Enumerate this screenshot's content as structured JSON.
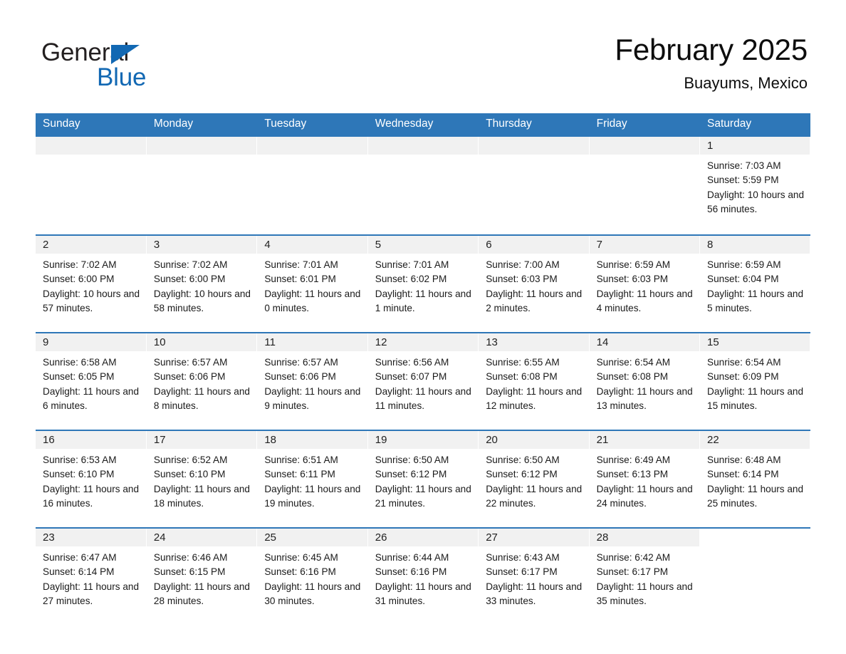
{
  "brand": {
    "name_part1": "General",
    "name_part2": "Blue",
    "triangle_color": "#1268b3",
    "text_color": "#231f20"
  },
  "header": {
    "title": "February 2025",
    "subtitle": "Buayums, Mexico"
  },
  "theme": {
    "header_blue": "#2e77b8",
    "daynum_band": "#f1f1f1",
    "cell_bg": "#ffffff",
    "text": "#1a1a1a"
  },
  "calendar": {
    "weekday_headers": [
      "Sunday",
      "Monday",
      "Tuesday",
      "Wednesday",
      "Thursday",
      "Friday",
      "Saturday"
    ],
    "weeks": [
      [
        {
          "blank": true
        },
        {
          "blank": true
        },
        {
          "blank": true
        },
        {
          "blank": true
        },
        {
          "blank": true
        },
        {
          "blank": true
        },
        {
          "day": "1",
          "sunrise": "Sunrise: 7:03 AM",
          "sunset": "Sunset: 5:59 PM",
          "daylight": "Daylight: 10 hours and 56 minutes."
        }
      ],
      [
        {
          "day": "2",
          "sunrise": "Sunrise: 7:02 AM",
          "sunset": "Sunset: 6:00 PM",
          "daylight": "Daylight: 10 hours and 57 minutes."
        },
        {
          "day": "3",
          "sunrise": "Sunrise: 7:02 AM",
          "sunset": "Sunset: 6:00 PM",
          "daylight": "Daylight: 10 hours and 58 minutes."
        },
        {
          "day": "4",
          "sunrise": "Sunrise: 7:01 AM",
          "sunset": "Sunset: 6:01 PM",
          "daylight": "Daylight: 11 hours and 0 minutes."
        },
        {
          "day": "5",
          "sunrise": "Sunrise: 7:01 AM",
          "sunset": "Sunset: 6:02 PM",
          "daylight": "Daylight: 11 hours and 1 minute."
        },
        {
          "day": "6",
          "sunrise": "Sunrise: 7:00 AM",
          "sunset": "Sunset: 6:03 PM",
          "daylight": "Daylight: 11 hours and 2 minutes."
        },
        {
          "day": "7",
          "sunrise": "Sunrise: 6:59 AM",
          "sunset": "Sunset: 6:03 PM",
          "daylight": "Daylight: 11 hours and 4 minutes."
        },
        {
          "day": "8",
          "sunrise": "Sunrise: 6:59 AM",
          "sunset": "Sunset: 6:04 PM",
          "daylight": "Daylight: 11 hours and 5 minutes."
        }
      ],
      [
        {
          "day": "9",
          "sunrise": "Sunrise: 6:58 AM",
          "sunset": "Sunset: 6:05 PM",
          "daylight": "Daylight: 11 hours and 6 minutes."
        },
        {
          "day": "10",
          "sunrise": "Sunrise: 6:57 AM",
          "sunset": "Sunset: 6:06 PM",
          "daylight": "Daylight: 11 hours and 8 minutes."
        },
        {
          "day": "11",
          "sunrise": "Sunrise: 6:57 AM",
          "sunset": "Sunset: 6:06 PM",
          "daylight": "Daylight: 11 hours and 9 minutes."
        },
        {
          "day": "12",
          "sunrise": "Sunrise: 6:56 AM",
          "sunset": "Sunset: 6:07 PM",
          "daylight": "Daylight: 11 hours and 11 minutes."
        },
        {
          "day": "13",
          "sunrise": "Sunrise: 6:55 AM",
          "sunset": "Sunset: 6:08 PM",
          "daylight": "Daylight: 11 hours and 12 minutes."
        },
        {
          "day": "14",
          "sunrise": "Sunrise: 6:54 AM",
          "sunset": "Sunset: 6:08 PM",
          "daylight": "Daylight: 11 hours and 13 minutes."
        },
        {
          "day": "15",
          "sunrise": "Sunrise: 6:54 AM",
          "sunset": "Sunset: 6:09 PM",
          "daylight": "Daylight: 11 hours and 15 minutes."
        }
      ],
      [
        {
          "day": "16",
          "sunrise": "Sunrise: 6:53 AM",
          "sunset": "Sunset: 6:10 PM",
          "daylight": "Daylight: 11 hours and 16 minutes."
        },
        {
          "day": "17",
          "sunrise": "Sunrise: 6:52 AM",
          "sunset": "Sunset: 6:10 PM",
          "daylight": "Daylight: 11 hours and 18 minutes."
        },
        {
          "day": "18",
          "sunrise": "Sunrise: 6:51 AM",
          "sunset": "Sunset: 6:11 PM",
          "daylight": "Daylight: 11 hours and 19 minutes."
        },
        {
          "day": "19",
          "sunrise": "Sunrise: 6:50 AM",
          "sunset": "Sunset: 6:12 PM",
          "daylight": "Daylight: 11 hours and 21 minutes."
        },
        {
          "day": "20",
          "sunrise": "Sunrise: 6:50 AM",
          "sunset": "Sunset: 6:12 PM",
          "daylight": "Daylight: 11 hours and 22 minutes."
        },
        {
          "day": "21",
          "sunrise": "Sunrise: 6:49 AM",
          "sunset": "Sunset: 6:13 PM",
          "daylight": "Daylight: 11 hours and 24 minutes."
        },
        {
          "day": "22",
          "sunrise": "Sunrise: 6:48 AM",
          "sunset": "Sunset: 6:14 PM",
          "daylight": "Daylight: 11 hours and 25 minutes."
        }
      ],
      [
        {
          "day": "23",
          "sunrise": "Sunrise: 6:47 AM",
          "sunset": "Sunset: 6:14 PM",
          "daylight": "Daylight: 11 hours and 27 minutes."
        },
        {
          "day": "24",
          "sunrise": "Sunrise: 6:46 AM",
          "sunset": "Sunset: 6:15 PM",
          "daylight": "Daylight: 11 hours and 28 minutes."
        },
        {
          "day": "25",
          "sunrise": "Sunrise: 6:45 AM",
          "sunset": "Sunset: 6:16 PM",
          "daylight": "Daylight: 11 hours and 30 minutes."
        },
        {
          "day": "26",
          "sunrise": "Sunrise: 6:44 AM",
          "sunset": "Sunset: 6:16 PM",
          "daylight": "Daylight: 11 hours and 31 minutes."
        },
        {
          "day": "27",
          "sunrise": "Sunrise: 6:43 AM",
          "sunset": "Sunset: 6:17 PM",
          "daylight": "Daylight: 11 hours and 33 minutes."
        },
        {
          "day": "28",
          "sunrise": "Sunrise: 6:42 AM",
          "sunset": "Sunset: 6:17 PM",
          "daylight": "Daylight: 11 hours and 35 minutes."
        },
        {
          "blank": true
        }
      ]
    ]
  }
}
